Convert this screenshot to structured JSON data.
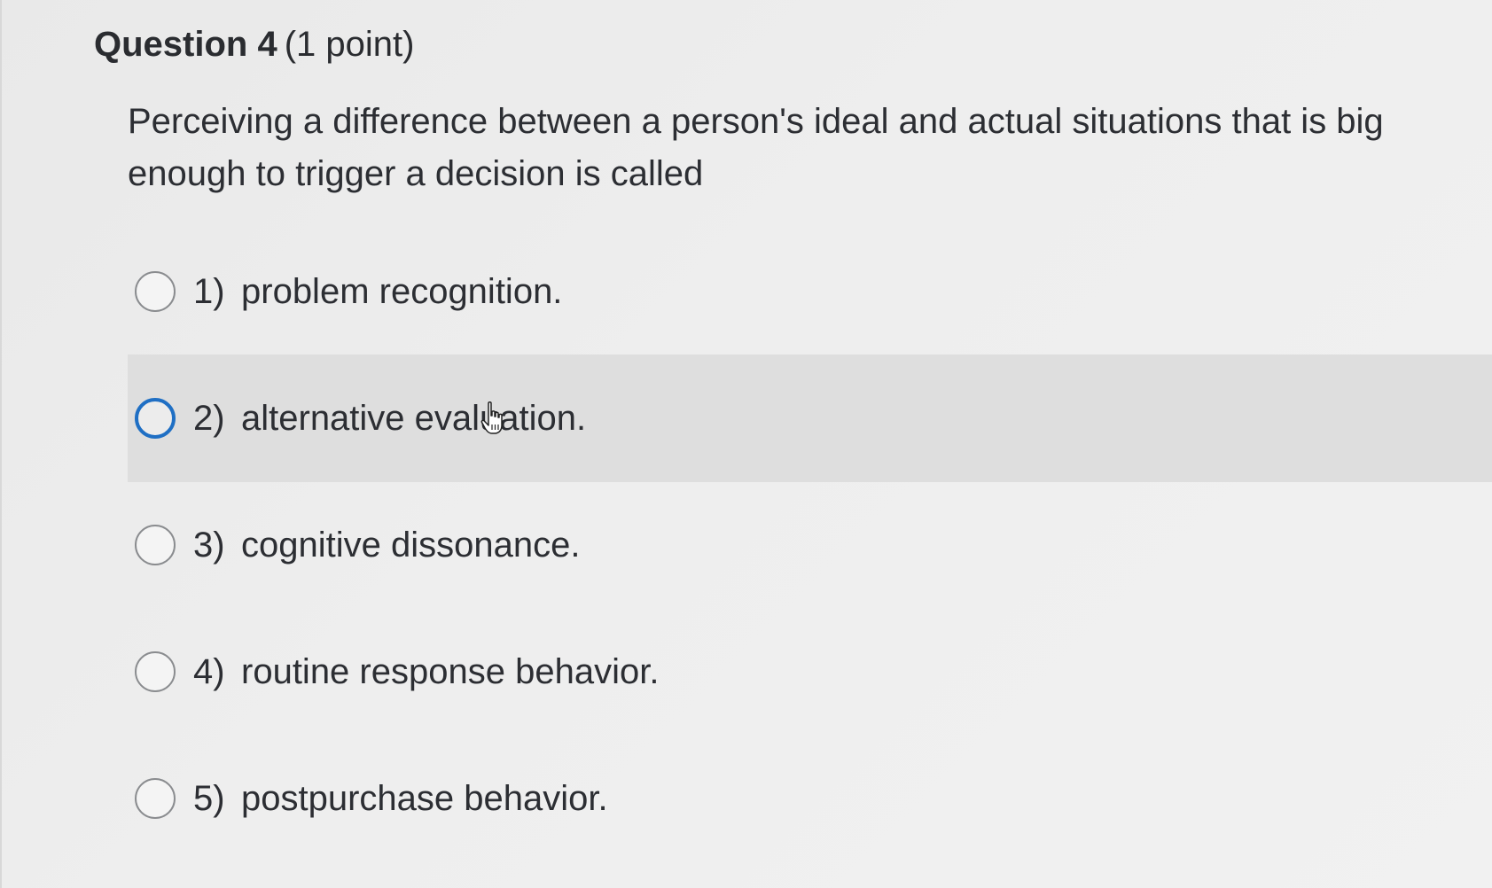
{
  "question": {
    "title": "Question 4",
    "points": "(1 point)",
    "text": "Perceiving a difference between a person's ideal and actual situations that is big enough to trigger a decision is called"
  },
  "options": [
    {
      "number": "1)",
      "label": "problem recognition."
    },
    {
      "number": "2)",
      "label": "alternative evaluation."
    },
    {
      "number": "3)",
      "label": "cognitive dissonance."
    },
    {
      "number": "4)",
      "label": "routine response behavior."
    },
    {
      "number": "5)",
      "label": "postpurchase behavior."
    }
  ],
  "state": {
    "hovered_option": 2,
    "selected_option": null,
    "cursor": "hand-pointer-icon"
  },
  "colors": {
    "text": "#2c2e33",
    "hover_background": "#dedede",
    "focus_radio": "#1f6fc4",
    "page_background": "#ececec"
  }
}
